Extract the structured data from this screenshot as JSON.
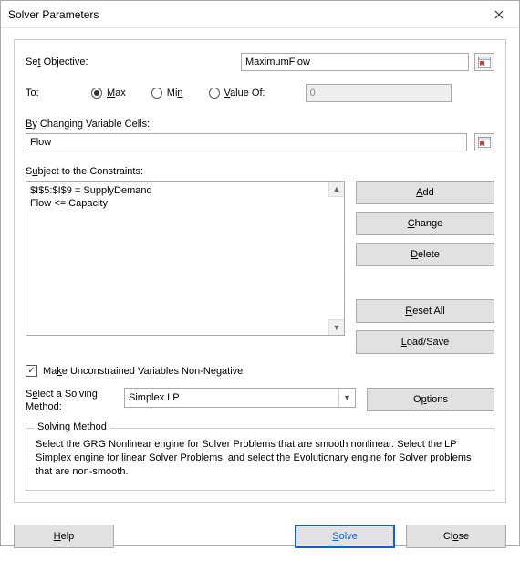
{
  "window": {
    "title": "Solver Parameters"
  },
  "labels": {
    "set_objective_pre": "Se",
    "set_objective_u": "t",
    "set_objective_post": " Objective:",
    "to": "To:",
    "max_u": "M",
    "max_post": "ax",
    "min_pre": "Mi",
    "min_u": "n",
    "value_of_u": "V",
    "value_of_post": "alue Of:",
    "by_u": "B",
    "by_post": "y Changing Variable Cells:",
    "subject_pre": "S",
    "subject_u": "u",
    "subject_post": "bject to the Constraints:",
    "make_pre": "Ma",
    "make_u": "k",
    "make_post": "e Unconstrained Variables Non-Negative",
    "select_pre": "S",
    "select_u": "e",
    "select_post": "lect a Solving",
    "select_line2": "Method:",
    "solving_method_header": "Solving Method",
    "solving_method_text": "Select the GRG Nonlinear engine for Solver Problems that are smooth nonlinear. Select the LP Simplex engine for linear Solver Problems, and select the Evolutionary engine for Solver problems that are non-smooth."
  },
  "fields": {
    "objective": "MaximumFlow",
    "value_of": "0",
    "changing_cells": "Flow",
    "solving_method": "Simplex LP"
  },
  "radios": {
    "selected": "max"
  },
  "constraints": [
    "$I$5:$I$9 = SupplyDemand",
    "Flow <= Capacity"
  ],
  "buttons": {
    "add_u": "A",
    "add_post": "dd",
    "change_u": "C",
    "change_post": "hange",
    "delete_u": "D",
    "delete_post": "elete",
    "reset_u": "R",
    "reset_post": "eset All",
    "loadsave_u": "L",
    "loadsave_post": "oad/Save",
    "options_pre": "O",
    "options_u": "p",
    "options_post": "tions",
    "help_u": "H",
    "help_post": "elp",
    "solve_u": "S",
    "solve_post": "olve",
    "close_pre": "Cl",
    "close_u": "o",
    "close_post": "se"
  },
  "checkbox": {
    "nonneg_checked": true
  }
}
